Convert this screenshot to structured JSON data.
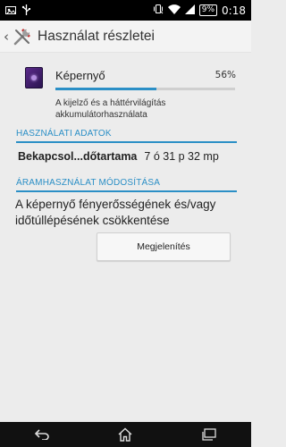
{
  "status_bar": {
    "battery": "9%",
    "time": "0:18"
  },
  "action_bar": {
    "title": "Használat részletei"
  },
  "screen_item": {
    "label": "Képernyő",
    "percent": "56%",
    "percent_value": 56,
    "description": "A kijelző és a háttérvilágítás akkumulátorhasználata"
  },
  "usage_section": {
    "header": "HASZNÁLATI ADATOK",
    "key": "Bekapcsol...dőtartama",
    "value": "7 ó 31 p 32 mp"
  },
  "power_section": {
    "header": "ÁRAMHASZNÁLAT MÓDOSÍTÁSA",
    "text": "A képernyő fényerősségének és/vagy időtúllépésének csökkentése",
    "button_label": "Megjelenítés"
  },
  "colors": {
    "accent": "#2b8fc6",
    "background": "#ececec"
  }
}
